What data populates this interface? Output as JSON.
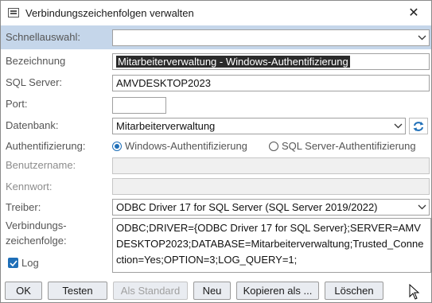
{
  "window": {
    "title": "Verbindungszeichenfolgen verwalten",
    "close_glyph": "✕"
  },
  "quick": {
    "label": "Schnellauswahl:",
    "value": ""
  },
  "form": {
    "name_label": "Bezeichnung",
    "name_value": "Mitarbeiterverwaltung - Windows-Authentifizierung",
    "server_label": "SQL Server:",
    "server_value": "AMVDESKTOP2023",
    "port_label": "Port:",
    "port_value": "",
    "db_label": "Datenbank:",
    "db_value": "Mitarbeiterverwaltung",
    "auth_label": "Authentifizierung:",
    "auth_windows": "Windows-Authentifizierung",
    "auth_sql": "SQL Server-Authentifizierung",
    "auth_selected": "windows",
    "user_label": "Benutzername:",
    "user_value": "",
    "pass_label": "Kennwort:",
    "pass_value": "",
    "driver_label": "Treiber:",
    "driver_value": "ODBC Driver 17 for SQL Server (SQL Server 2019/2022)",
    "conn_label_1": "Verbindungs-",
    "conn_label_2": "zeichenfolge:",
    "conn_value": "ODBC;DRIVER={ODBC Driver 17 for SQL Server};SERVER=AMVDESKTOP2023;DATABASE=Mitarbeiterverwaltung;Trusted_Connection=Yes;OPTION=3;LOG_QUERY=1;",
    "log_label": "Log",
    "log_checked": true
  },
  "buttons": {
    "ok": "OK",
    "test": "Testen",
    "default": "Als Standard",
    "new": "Neu",
    "copy": "Kopieren als ...",
    "delete": "Löschen"
  },
  "colors": {
    "accent": "#1f6fb8",
    "quick_row": "#c5d6ea",
    "selection": "#2b2b2b"
  }
}
